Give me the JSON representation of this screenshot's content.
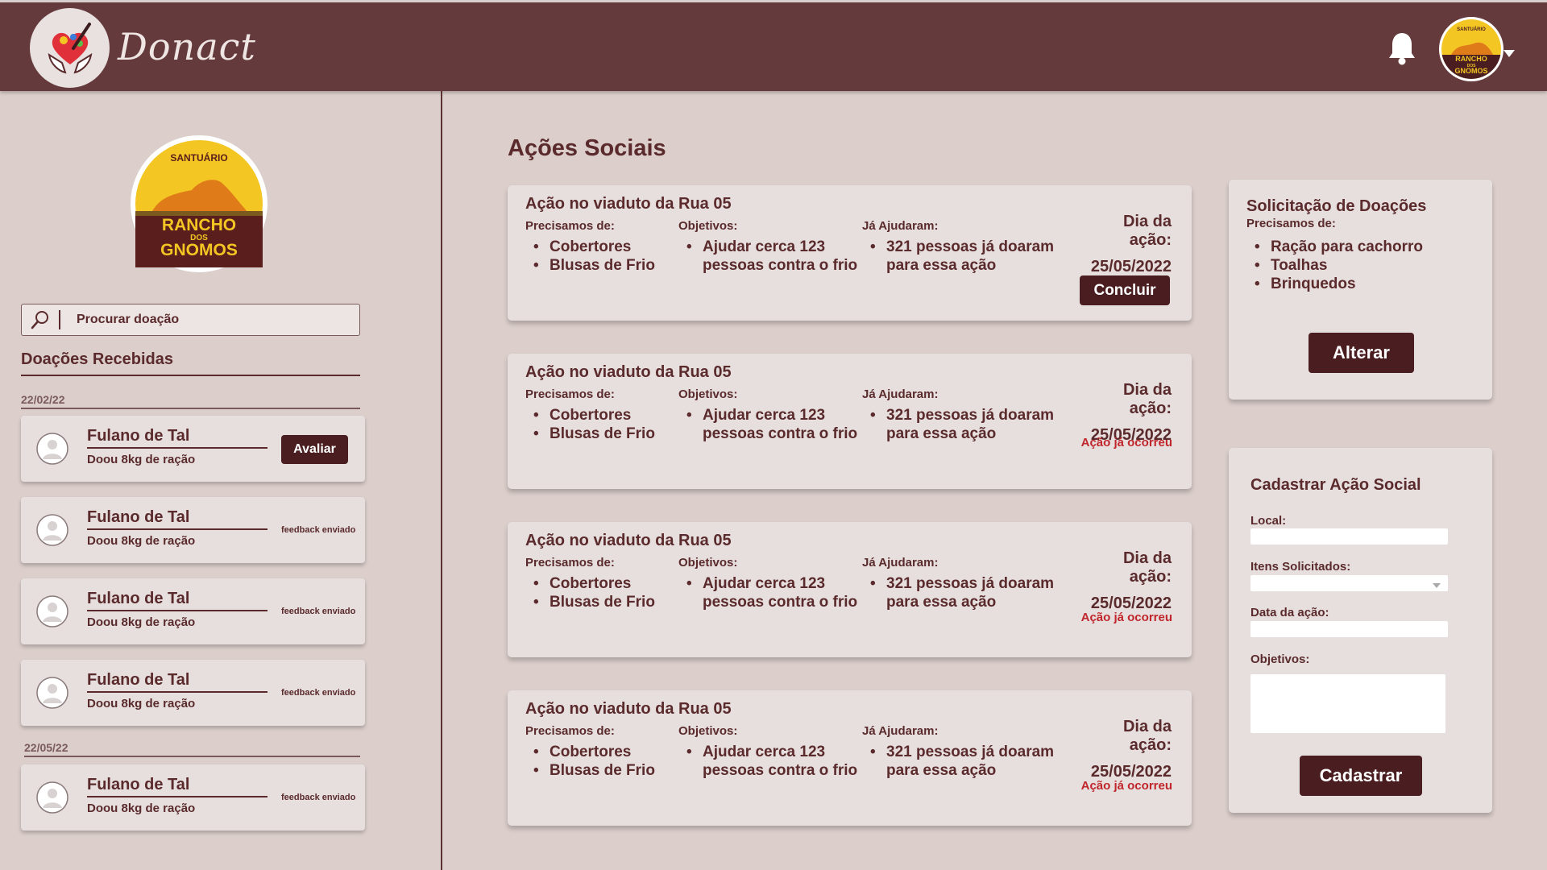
{
  "header": {
    "brand": "Donact",
    "logo_icon": "heart-hands-icon",
    "bell_icon": "bell-icon",
    "avatar_icon": "org-avatar-icon"
  },
  "sidebar": {
    "org_logo": {
      "top": "SANTUÁRIO",
      "line1": "RANCHO",
      "line2": "DOS",
      "line3": "GNOMOS"
    },
    "search_placeholder": "Procurar doação",
    "section_title": "Doações Recebidas",
    "groups": [
      {
        "date": "22/02/22",
        "items": [
          {
            "name": "Fulano de Tal",
            "desc": "Doou 8kg de ração",
            "action": "Avaliar"
          },
          {
            "name": "Fulano de Tal",
            "desc": "Doou 8kg de ração",
            "status": "feedback enviado"
          },
          {
            "name": "Fulano de Tal",
            "desc": "Doou 8kg de ração",
            "status": "feedback enviado"
          },
          {
            "name": "Fulano de Tal",
            "desc": "Doou 8kg de ração",
            "status": "feedback enviado"
          }
        ]
      },
      {
        "date": "22/05/22",
        "items": [
          {
            "name": "Fulano de Tal",
            "desc": "Doou 8kg de ração",
            "status": "feedback enviado"
          }
        ]
      }
    ]
  },
  "main": {
    "title": "Ações Sociais",
    "actions": [
      {
        "title": "Ação no viaduto da Rua 05",
        "needs_label": "Precisamos de:",
        "needs": [
          "Cobertores",
          "Blusas de Frio"
        ],
        "goals_label": "Objetivos:",
        "goals": [
          "Ajudar cerca 123",
          "pessoas contra o frio"
        ],
        "helped_label": "Já Ajudaram:",
        "helped": [
          "321 pessoas já doaram",
          "para essa ação"
        ],
        "day_label": "Dia da ação:",
        "day": "25/05/2022",
        "button": "Concluir"
      },
      {
        "title": "Ação no viaduto da Rua 05",
        "needs_label": "Precisamos de:",
        "needs": [
          "Cobertores",
          "Blusas de Frio"
        ],
        "goals_label": "Objetivos:",
        "goals": [
          "Ajudar cerca 123",
          "pessoas contra o frio"
        ],
        "helped_label": "Já Ajudaram:",
        "helped": [
          "321 pessoas já doaram",
          "para essa ação"
        ],
        "day_label": "Dia da ação:",
        "day": "25/05/2022",
        "status": "Ação já ocorreu"
      },
      {
        "title": "Ação no viaduto da Rua 05",
        "needs_label": "Precisamos de:",
        "needs": [
          "Cobertores",
          "Blusas de Frio"
        ],
        "goals_label": "Objetivos:",
        "goals": [
          "Ajudar cerca 123",
          "pessoas contra o frio"
        ],
        "helped_label": "Já Ajudaram:",
        "helped": [
          "321 pessoas já doaram",
          "para essa ação"
        ],
        "day_label": "Dia da ação:",
        "day": "25/05/2022",
        "status": "Ação já ocorreu"
      },
      {
        "title": "Ação no viaduto da Rua 05",
        "needs_label": "Precisamos de:",
        "needs": [
          "Cobertores",
          "Blusas de Frio"
        ],
        "goals_label": "Objetivos:",
        "goals": [
          "Ajudar cerca 123",
          "pessoas contra o frio"
        ],
        "helped_label": "Já Ajudaram:",
        "helped": [
          "321 pessoas já doaram",
          "para essa ação"
        ],
        "day_label": "Dia da ação:",
        "day": "25/05/2022",
        "status": "Ação já ocorreu"
      }
    ]
  },
  "request_panel": {
    "title": "Solicitação de Doações",
    "subtitle": "Precisamos de:",
    "items": [
      "Ração para cachorro",
      "Toalhas",
      "Brinquedos"
    ],
    "button": "Alterar"
  },
  "register_panel": {
    "title": "Cadastrar Ação Social",
    "local_label": "Local:",
    "items_label": "Itens Solicitados:",
    "date_label": "Data da ação:",
    "goals_label": "Objetivos:",
    "button": "Cadastrar"
  },
  "colors": {
    "header": "#643a3d",
    "background": "#dbcecb",
    "card": "#e6dfdd",
    "text": "#5a2a2c",
    "button": "#4a1d20",
    "alert": "#c0262c"
  }
}
